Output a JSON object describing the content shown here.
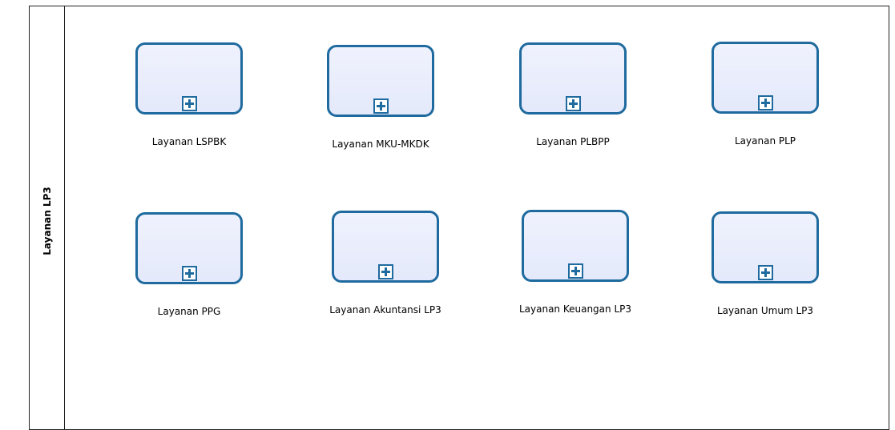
{
  "lane": {
    "title": "Layanan LP3"
  },
  "colors": {
    "task_border": "#1f6a9e",
    "task_fill": "#e8ecfc",
    "pool_border": "#222222"
  },
  "subprocesses": [
    {
      "label": "Layanan LSPBK",
      "icon": "collapsed-subprocess-plus-icon"
    },
    {
      "label": "Layanan MKU-MKDK",
      "icon": "collapsed-subprocess-plus-icon"
    },
    {
      "label": "Layanan PLBPP",
      "icon": "collapsed-subprocess-plus-icon"
    },
    {
      "label": "Layanan PLP",
      "icon": "collapsed-subprocess-plus-icon"
    },
    {
      "label": "Layanan PPG",
      "icon": "collapsed-subprocess-plus-icon"
    },
    {
      "label": "Layanan Akuntansi LP3",
      "icon": "collapsed-subprocess-plus-icon"
    },
    {
      "label": "Layanan Keuangan LP3",
      "icon": "collapsed-subprocess-plus-icon"
    },
    {
      "label": "Layanan Umum LP3",
      "icon": "collapsed-subprocess-plus-icon"
    }
  ]
}
